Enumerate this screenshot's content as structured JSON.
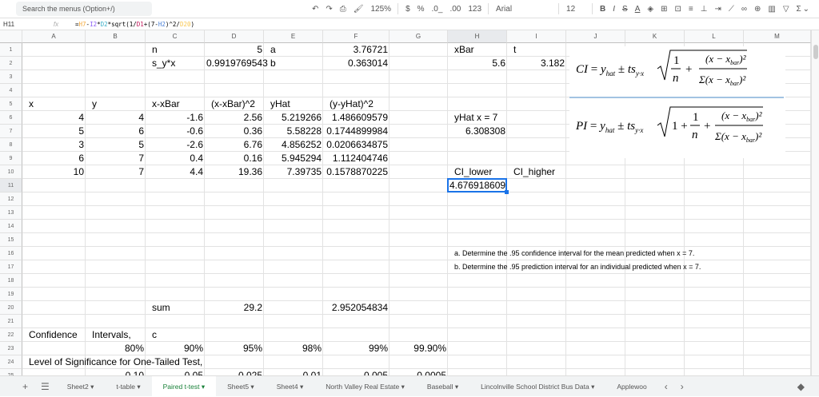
{
  "toolbar": {
    "search_placeholder": "Search the menus (Option+/)",
    "zoom": "125%",
    "currency": "$",
    "percent": "%",
    "dec_less": ".0_",
    "dec_more": ".00",
    "format": "123",
    "font": "Arial",
    "font_size": "12",
    "bold": "B",
    "italic": "I",
    "strike": "S",
    "text_color": "A",
    "sum": "Σ"
  },
  "formula_bar": {
    "cell_ref": "H11",
    "fx": "fx",
    "tokens": [
      {
        "t": "=",
        "c": "#000"
      },
      {
        "t": "H7",
        "c": "#f4a93a"
      },
      {
        "t": "-",
        "c": "#000"
      },
      {
        "t": "I2",
        "c": "#8b5cf6"
      },
      {
        "t": "*",
        "c": "#000"
      },
      {
        "t": "D2",
        "c": "#3bb0c9"
      },
      {
        "t": "*sqrt(1/",
        "c": "#000"
      },
      {
        "t": "D1",
        "c": "#c2185b"
      },
      {
        "t": "+(7-",
        "c": "#000"
      },
      {
        "t": "H2",
        "c": "#4a7fd6"
      },
      {
        "t": ")^2/",
        "c": "#000"
      },
      {
        "t": "D20",
        "c": "#f9c74f"
      },
      {
        "t": ")",
        "c": "#000"
      }
    ]
  },
  "columns": [
    "A",
    "B",
    "C",
    "D",
    "E",
    "F",
    "G",
    "H",
    "I",
    "J",
    "K",
    "L",
    "M"
  ],
  "selected_cell": "H11",
  "cells": [
    {
      "ref": "C1",
      "v": "n"
    },
    {
      "ref": "D1",
      "v": "5"
    },
    {
      "ref": "E1",
      "v": "a"
    },
    {
      "ref": "F1",
      "v": "3.76721"
    },
    {
      "ref": "H1",
      "v": "xBar"
    },
    {
      "ref": "I1",
      "v": "t"
    },
    {
      "ref": "C2",
      "v": "s_y*x"
    },
    {
      "ref": "D2",
      "v": "0.9919769543"
    },
    {
      "ref": "E2",
      "v": "b"
    },
    {
      "ref": "F2",
      "v": "0.363014"
    },
    {
      "ref": "H2",
      "v": "5.6"
    },
    {
      "ref": "I2",
      "v": "3.182"
    },
    {
      "ref": "A5",
      "v": "x"
    },
    {
      "ref": "B5",
      "v": "y"
    },
    {
      "ref": "C5",
      "v": "x-xBar"
    },
    {
      "ref": "D5",
      "v": "(x-xBar)^2"
    },
    {
      "ref": "E5",
      "v": "yHat"
    },
    {
      "ref": "F5",
      "v": "(y-yHat)^2"
    },
    {
      "ref": "A6",
      "v": "4"
    },
    {
      "ref": "B6",
      "v": "4"
    },
    {
      "ref": "C6",
      "v": "-1.6"
    },
    {
      "ref": "D6",
      "v": "2.56"
    },
    {
      "ref": "E6",
      "v": "5.219266"
    },
    {
      "ref": "F6",
      "v": "1.486609579"
    },
    {
      "ref": "H6",
      "v": "yHat x = 7"
    },
    {
      "ref": "A7",
      "v": "5"
    },
    {
      "ref": "B7",
      "v": "6"
    },
    {
      "ref": "C7",
      "v": "-0.6"
    },
    {
      "ref": "D7",
      "v": "0.36"
    },
    {
      "ref": "E7",
      "v": "5.58228"
    },
    {
      "ref": "F7",
      "v": "0.1744899984"
    },
    {
      "ref": "H7",
      "v": "6.308308"
    },
    {
      "ref": "A8",
      "v": "3"
    },
    {
      "ref": "B8",
      "v": "5"
    },
    {
      "ref": "C8",
      "v": "-2.6"
    },
    {
      "ref": "D8",
      "v": "6.76"
    },
    {
      "ref": "E8",
      "v": "4.856252"
    },
    {
      "ref": "F8",
      "v": "0.0206634875"
    },
    {
      "ref": "A9",
      "v": "6"
    },
    {
      "ref": "B9",
      "v": "7"
    },
    {
      "ref": "C9",
      "v": "0.4"
    },
    {
      "ref": "D9",
      "v": "0.16"
    },
    {
      "ref": "E9",
      "v": "5.945294"
    },
    {
      "ref": "F9",
      "v": "1.112404746"
    },
    {
      "ref": "A10",
      "v": "10"
    },
    {
      "ref": "B10",
      "v": "7"
    },
    {
      "ref": "C10",
      "v": "4.4"
    },
    {
      "ref": "D10",
      "v": "19.36"
    },
    {
      "ref": "E10",
      "v": "7.39735"
    },
    {
      "ref": "F10",
      "v": "0.1578870225"
    },
    {
      "ref": "H10",
      "v": "CI_lower"
    },
    {
      "ref": "I10",
      "v": "CI_higher"
    },
    {
      "ref": "H11",
      "v": "4.676918609"
    },
    {
      "ref": "H16",
      "v": "a. Determine the .95 confidence interval for the mean predicted when x = 7.",
      "small": true
    },
    {
      "ref": "H17",
      "v": "b. Determine the .95 prediction interval for an individual predicted when x = 7.",
      "small": true
    },
    {
      "ref": "C20",
      "v": "sum"
    },
    {
      "ref": "D20",
      "v": "29.2"
    },
    {
      "ref": "F20",
      "v": "2.952054834"
    },
    {
      "ref": "A22",
      "v": "Confidence"
    },
    {
      "ref": "B22",
      "v": "Intervals,"
    },
    {
      "ref": "C22",
      "v": "c"
    },
    {
      "ref": "B23",
      "v": "80%"
    },
    {
      "ref": "C23",
      "v": "90%"
    },
    {
      "ref": "D23",
      "v": "95%"
    },
    {
      "ref": "E23",
      "v": "98%"
    },
    {
      "ref": "F23",
      "v": "99%"
    },
    {
      "ref": "G23",
      "v": "99.90%"
    },
    {
      "ref": "A24",
      "v": "Level of Significance for One-Tailed Test,"
    },
    {
      "ref": "B25",
      "v": "0.10"
    },
    {
      "ref": "C25",
      "v": "0.05"
    },
    {
      "ref": "D25",
      "v": "0.025"
    },
    {
      "ref": "E25",
      "v": "0.01"
    },
    {
      "ref": "F25",
      "v": "0.005"
    },
    {
      "ref": "G25",
      "v": "0.0005"
    }
  ],
  "formulas": {
    "ci": {
      "lhs": "CI",
      "rhs": "= y",
      "hat": "hat",
      "pm": "± ts",
      "sub": "y·x",
      "one": "1",
      "n": "n",
      "num": "(x − x",
      "bar": "bar",
      "sq": ")²",
      "den": "Σ(x − x"
    },
    "pi": {
      "lhs": "PI",
      "one_plus": "1 +"
    }
  },
  "sheet_tabs": [
    "Sheet2",
    "t-table",
    "Paired t-test",
    "Sheet5",
    "Sheet4",
    "North Valley Real Estate",
    "Baseball",
    "Lincolnville School District Bus Data",
    "Applewoo"
  ],
  "active_tab": "Paired t-test"
}
